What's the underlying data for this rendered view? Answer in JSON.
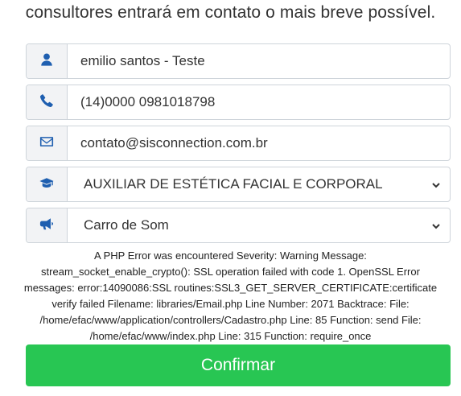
{
  "intro_text": "consultores entrará em contato o mais breve possível.",
  "form": {
    "name_value": "emilio santos - Teste",
    "phone_value": "(14)0000 0981018798",
    "email_value": "contato@sisconnection.com.br",
    "course_selected": "AUXILIAR DE ESTÉTICA FACIAL E CORPORAL",
    "source_selected": "Carro de Som"
  },
  "error_lines": [
    "A PHP Error was encountered Severity: Warning Message:",
    "stream_socket_enable_crypto(): SSL operation failed with code 1. OpenSSL Error",
    "messages: error:14090086:SSL routines:SSL3_GET_SERVER_CERTIFICATE:certificate",
    "verify failed Filename: libraries/Email.php Line Number: 2071 Backtrace: File:",
    "/home/efac/www/application/controllers/Cadastro.php Line: 85 Function: send File:",
    "/home/efac/www/index.php Line: 315 Function: require_once"
  ],
  "submit_label": "Confirmar",
  "icons": [
    "user-icon",
    "phone-icon",
    "envelope-icon",
    "graduation-cap-icon",
    "megaphone-icon",
    "chevron-down-icon"
  ],
  "colors": {
    "icon": "#1f5fb0",
    "button": "#28c653",
    "addon_bg": "#f2f3f5"
  }
}
